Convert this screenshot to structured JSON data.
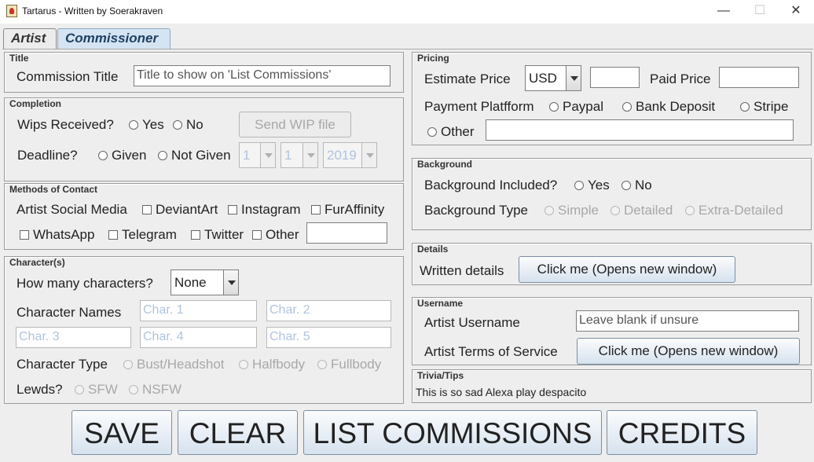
{
  "window": {
    "title": "Tartarus - Written by Soerakraven",
    "minimize_glyph": "—",
    "maximize_glyph": "☐",
    "close_glyph": "✕"
  },
  "tabs": [
    {
      "label": "Artist",
      "active": false
    },
    {
      "label": "Commissioner",
      "active": true
    }
  ],
  "title_section": {
    "legend": "Title",
    "commission_title_label": "Commission Title",
    "commission_title_value": "Title to show on 'List Commissions'"
  },
  "completion": {
    "legend": "Completion",
    "wips_label": "Wips Received?",
    "wips_yes": "Yes",
    "wips_no": "No",
    "send_wip_button": "Send WIP file",
    "deadline_label": "Deadline?",
    "deadline_given": "Given",
    "deadline_not_given": "Not Given",
    "day_value": "1",
    "month_value": "1",
    "year_value": "2019"
  },
  "contact": {
    "legend": "Methods of Contact",
    "social_label": "Artist Social Media",
    "deviantart": "DeviantArt",
    "instagram": "Instagram",
    "furaffinity": "FurAffinity",
    "whatsapp": "WhatsApp",
    "telegram": "Telegram",
    "twitter": "Twitter",
    "other": "Other",
    "other_value": ""
  },
  "characters": {
    "legend": "Character(s)",
    "how_many_label": "How many characters?",
    "how_many_value": "None",
    "names_label": "Character Names",
    "char1": "Char. 1",
    "char2": "Char. 2",
    "char3": "Char. 3",
    "char4": "Char. 4",
    "char5": "Char. 5",
    "type_label": "Character Type",
    "type_bust": "Bust/Headshot",
    "type_half": "Halfbody",
    "type_full": "Fullbody",
    "lewds_label": "Lewds?",
    "lewds_sfw": "SFW",
    "lewds_nsfw": "NSFW"
  },
  "pricing": {
    "legend": "Pricing",
    "estimate_label": "Estimate Price",
    "currency_value": "USD",
    "estimate_value": "",
    "paid_label": "Paid Price",
    "paid_value": "",
    "platform_label": "Payment Platfform",
    "paypal": "Paypal",
    "bank": "Bank Deposit",
    "stripe": "Stripe",
    "other": "Other",
    "other_value": ""
  },
  "background": {
    "legend": "Background",
    "included_label": "Background Included?",
    "yes": "Yes",
    "no": "No",
    "type_label": "Background Type",
    "simple": "Simple",
    "detailed": "Detailed",
    "extra": "Extra-Detailed"
  },
  "details": {
    "legend": "Details",
    "written_label": "Written details",
    "open_button": "Click me (Opens new window)"
  },
  "username": {
    "legend": "Username",
    "artist_username_label": "Artist Username",
    "artist_username_value": "Leave blank if unsure",
    "tos_label": "Artist Terms of Service",
    "tos_button": "Click me (Opens new window)"
  },
  "trivia": {
    "legend": "Trivia/Tips",
    "text": "This is so sad Alexa play despacito"
  },
  "actions": {
    "save": "SAVE",
    "clear": "CLEAR",
    "list": "LIST COMMISSIONS",
    "credits": "CREDITS"
  }
}
